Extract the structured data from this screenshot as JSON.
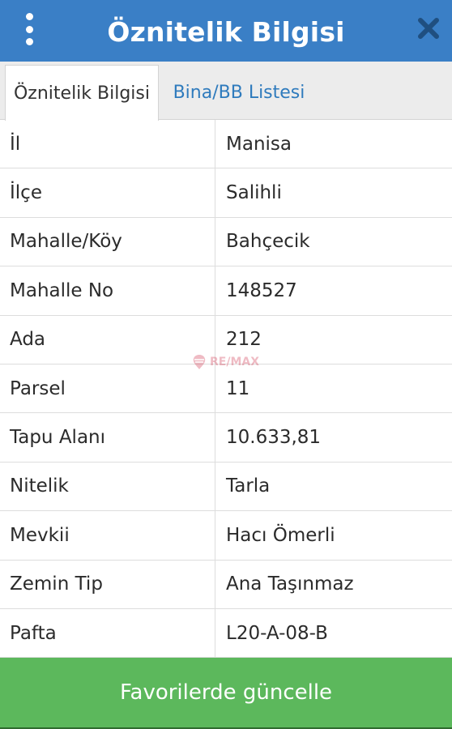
{
  "header": {
    "title": "Öznitelik Bilgisi",
    "menu_icon": "more-vertical-icon",
    "close_icon": "close-icon",
    "color": "#3a7fc6"
  },
  "tabs": [
    {
      "label": "Öznitelik Bilgisi",
      "active": true
    },
    {
      "label": "Bina/BB Listesi",
      "active": false
    }
  ],
  "rows": [
    {
      "label": "İl",
      "value": "Manisa"
    },
    {
      "label": "İlçe",
      "value": "Salihli"
    },
    {
      "label": "Mahalle/Köy",
      "value": "Bahçecik"
    },
    {
      "label": "Mahalle No",
      "value": "148527"
    },
    {
      "label": "Ada",
      "value": "212"
    },
    {
      "label": "Parsel",
      "value": "11"
    },
    {
      "label": "Tapu Alanı",
      "value": "10.633,81"
    },
    {
      "label": "Nitelik",
      "value": "Tarla"
    },
    {
      "label": "Mevkii",
      "value": "Hacı Ömerli"
    },
    {
      "label": "Zemin Tip",
      "value": "Ana Taşınmaz"
    },
    {
      "label": "Pafta",
      "value": "L20-A-08-B"
    }
  ],
  "watermark": {
    "text": "RE/MAX"
  },
  "footer": {
    "button_label": "Favorilerde güncelle",
    "color": "#5cb85c"
  }
}
